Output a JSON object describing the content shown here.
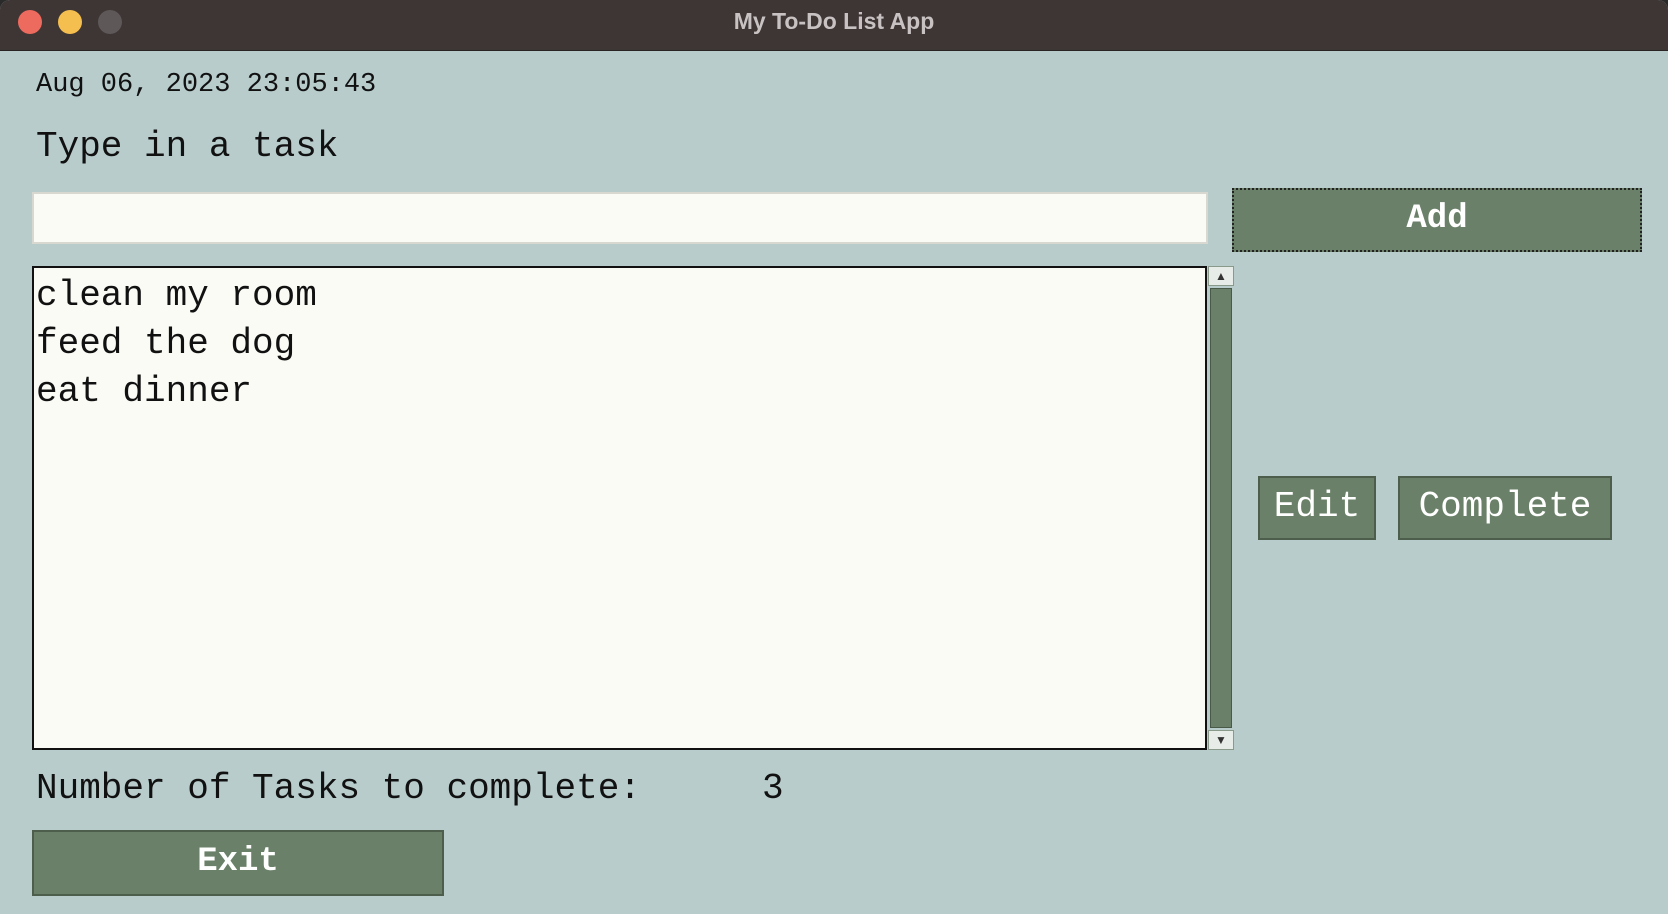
{
  "window": {
    "title": "My To-Do List App"
  },
  "app": {
    "datetime": "Aug 06, 2023 23:05:43",
    "prompt": "Type in a task",
    "task_input": {
      "value": "",
      "placeholder": ""
    },
    "add_label": "Add",
    "tasks": [
      "clean my room",
      "feed the dog",
      "eat dinner"
    ],
    "edit_label": "Edit",
    "complete_label": "Complete",
    "count_label": "Number of Tasks to complete:",
    "count_value": "3",
    "exit_label": "Exit"
  },
  "colors": {
    "background": "#b8cccc",
    "button": "#6a8068",
    "list_background": "#fbfbf6",
    "titlebar": "#3e3535"
  },
  "icons": {
    "scroll_up": "triangle-up-icon",
    "scroll_down": "triangle-down-icon"
  }
}
